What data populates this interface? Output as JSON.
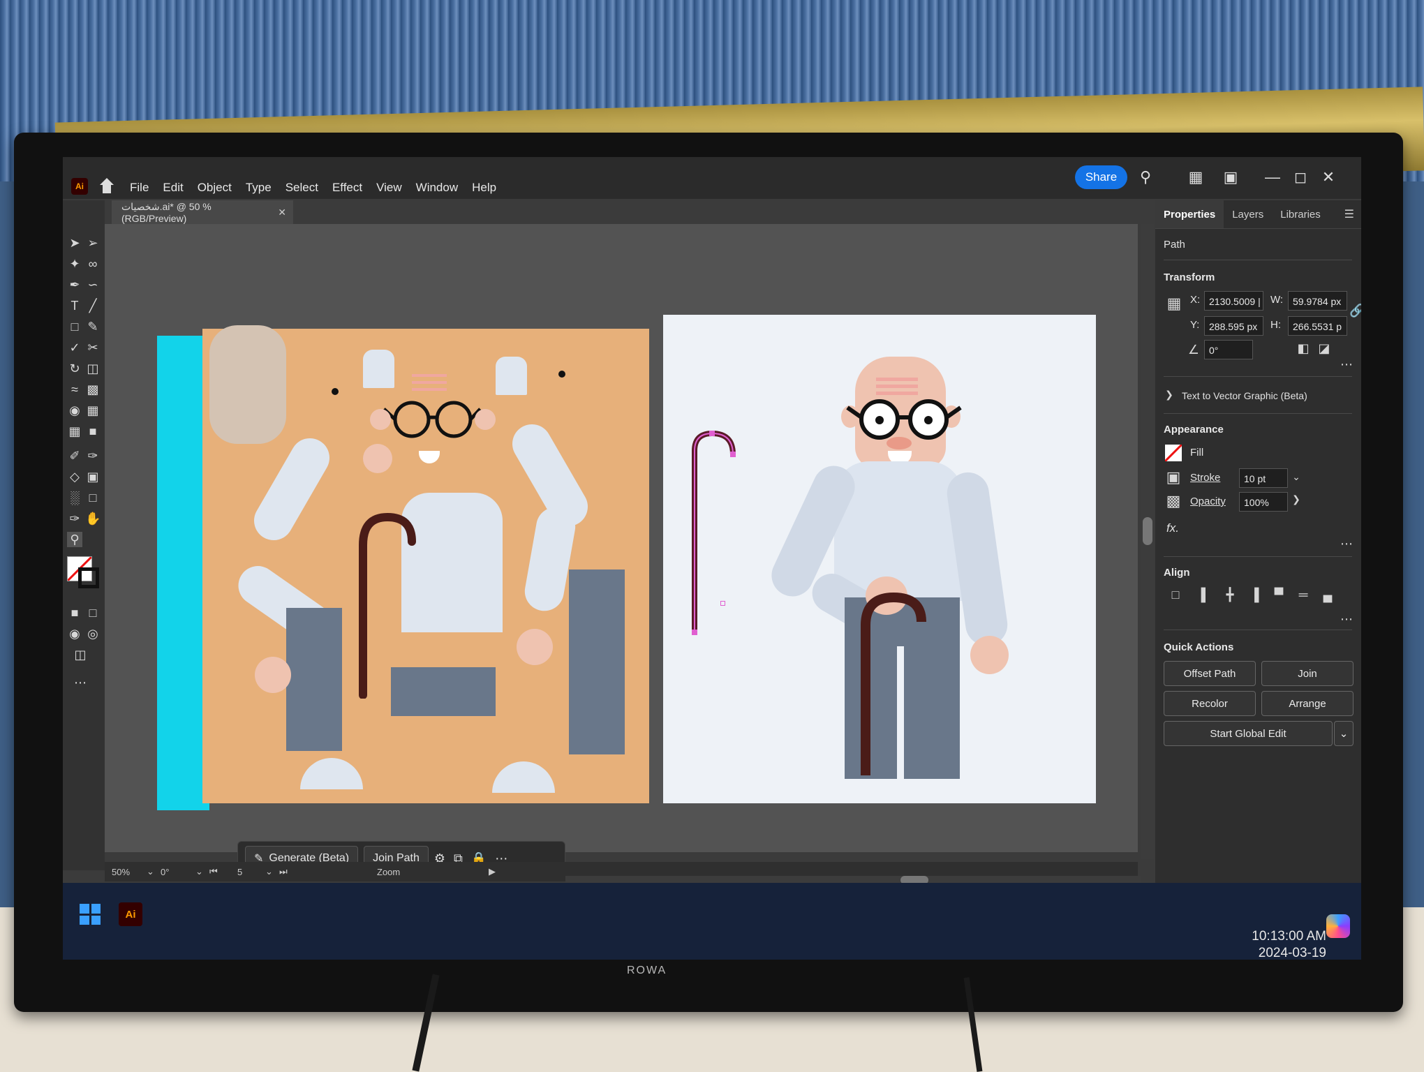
{
  "app": {
    "logo": "Ai",
    "menu": [
      "File",
      "Edit",
      "Object",
      "Type",
      "Select",
      "Effect",
      "View",
      "Window",
      "Help"
    ],
    "share_label": "Share",
    "document_tab": "شخصيات.ai* @ 50 % (RGB/Preview)"
  },
  "panel": {
    "tabs": [
      "Properties",
      "Layers",
      "Libraries"
    ],
    "object_type": "Path",
    "transform": {
      "title": "Transform",
      "x_label": "X:",
      "x_value": "2130.5009 |",
      "y_label": "Y:",
      "y_value": "288.595 px",
      "w_label": "W:",
      "w_value": "59.9784 px",
      "h_label": "H:",
      "h_value": "266.5531 p",
      "angle_value": "0°"
    },
    "text_to_vector": "Text to Vector Graphic (Beta)",
    "appearance": {
      "title": "Appearance",
      "fill_label": "Fill",
      "stroke_label": "Stroke",
      "stroke_value": "10 pt",
      "opacity_label": "Opacity",
      "opacity_value": "100%",
      "fx_label": "fx."
    },
    "align_title": "Align",
    "quick_actions": {
      "title": "Quick Actions",
      "offset_path": "Offset Path",
      "join": "Join",
      "recolor": "Recolor",
      "arrange": "Arrange",
      "start_global_edit": "Start Global Edit"
    }
  },
  "context_bar": {
    "generate": "Generate (Beta)",
    "join_path": "Join Path"
  },
  "status": {
    "zoom": "50%",
    "rotation": "0°",
    "artboard": "5",
    "mode": "Zoom"
  },
  "taskbar": {
    "app_label": "Ai",
    "time": "10:13:00 AM",
    "date": "2024-03-19"
  },
  "tv_brand": "ROWA",
  "colors": {
    "accent": "#1473e6",
    "artboard_orange": "#e7b07a",
    "cyan": "#12d3ea",
    "cane": "#4a1c18",
    "shirt": "#dce4ef",
    "pants": "#69778a",
    "skin": "#efc3b0"
  }
}
